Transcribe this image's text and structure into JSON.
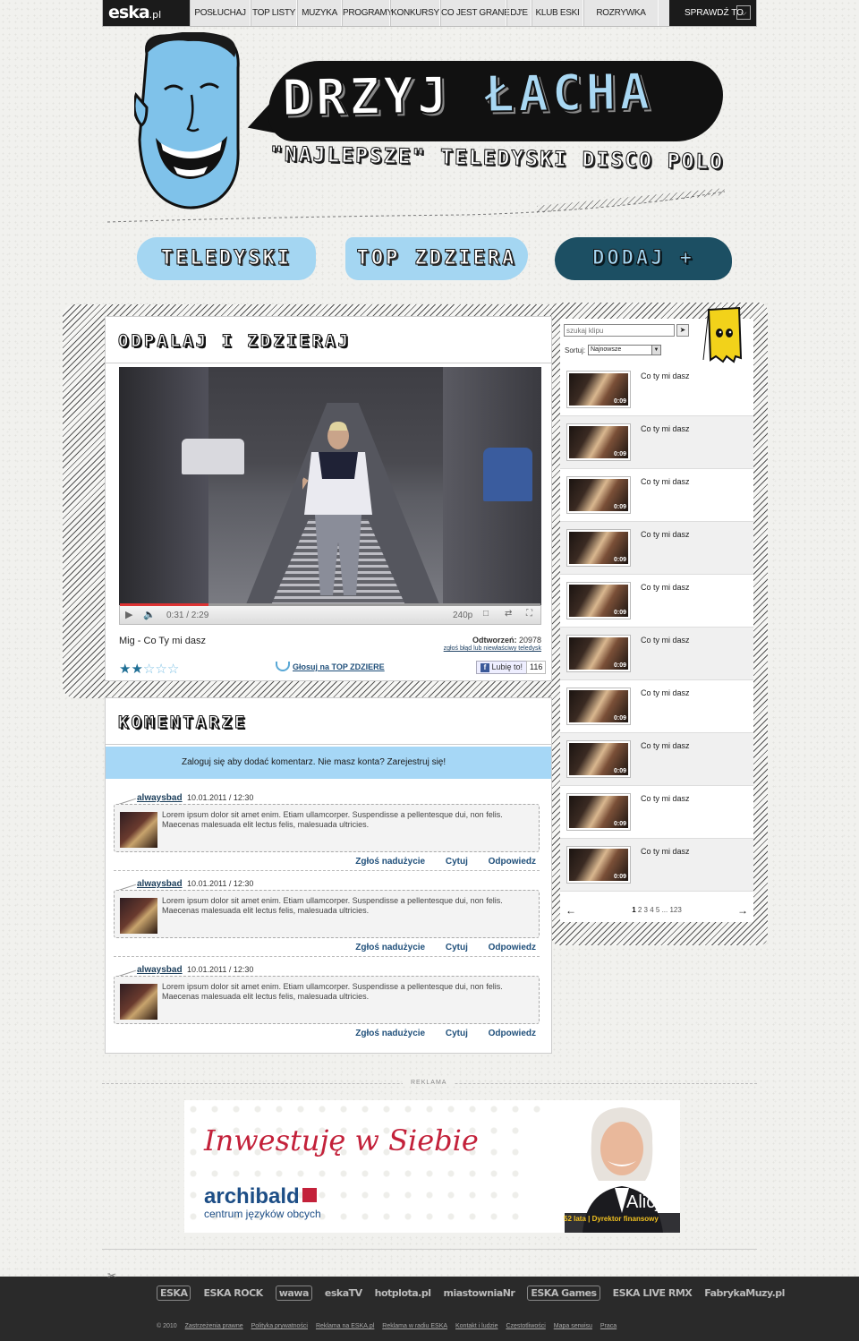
{
  "nav": {
    "logo": "eska",
    "logo_suffix": ".pl",
    "items": [
      "POSŁUCHAJ",
      "TOP LISTY",
      "MUZYKA",
      "PROGRAMY",
      "KONKURSY",
      "CO JEST GRANE",
      "DJ'E",
      "KLUB ESKI",
      "ROZRYWKA"
    ],
    "check_label": "SPRAWDŹ TO"
  },
  "header": {
    "title_part1": "DRZYJ",
    "title_part2": "ŁACHA",
    "tagline": "\"NAJLEPSZE\" TELEDYSKI DISCO POLO"
  },
  "main_buttons": [
    "TELEDYSKI",
    "TOP ZDZIERA",
    "DODAJ +"
  ],
  "video_panel": {
    "title": "ODPALAJ I ZDZIERAJ",
    "time": "0:31 / 2:29",
    "quality": "240p",
    "progress": 0.21,
    "video_name": "Mig - Co Ty mi dasz",
    "plays_label": "Odtworzeń:",
    "plays_value": "20978",
    "report_link": "zgłoś błąd lub niewłaściwy teledysk",
    "rating": 2,
    "rating_max": 5,
    "vote_label": "Głosuj na TOP ZDZIERE",
    "like_label": "Lubię to!",
    "like_count": "116"
  },
  "comments_panel": {
    "title": "KOMENTARZE",
    "login_prompt": "Zaloguj się aby dodać komentarz. Nie masz konta? Zarejestruj się!",
    "comments": [
      {
        "author": "alwaysbad",
        "date": "10.01.2011 / 12:30",
        "text": "Lorem ipsum dolor sit amet enim. Etiam ullamcorper. Suspendisse a pellentesque dui, non felis. Maecenas malesuada elit lectus felis, malesuada ultricies."
      },
      {
        "author": "alwaysbad",
        "date": "10.01.2011 / 12:30",
        "text": "Lorem ipsum dolor sit amet enim. Etiam ullamcorper. Suspendisse a pellentesque dui, non felis. Maecenas malesuada elit lectus felis, malesuada ultricies."
      },
      {
        "author": "alwaysbad",
        "date": "10.01.2011 / 12:30",
        "text": "Lorem ipsum dolor sit amet enim. Etiam ullamcorper. Suspendisse a pellentesque dui, non felis. Maecenas malesuada elit lectus felis, malesuada ultricies."
      }
    ],
    "actions": [
      "Zgłoś nadużycie",
      "Cytuj",
      "Odpowiedz"
    ]
  },
  "sidebar": {
    "search_placeholder": "szukaj klipu",
    "sort_label": "Sortuj:",
    "sort_value": "Najnowsze",
    "clips": [
      {
        "title": "Co ty mi dasz",
        "duration": "0:09"
      },
      {
        "title": "Co ty mi dasz",
        "duration": "0:09"
      },
      {
        "title": "Co ty mi dasz",
        "duration": "0:09"
      },
      {
        "title": "Co ty mi dasz",
        "duration": "0:09"
      },
      {
        "title": "Co ty mi dasz",
        "duration": "0:09"
      },
      {
        "title": "Co ty mi dasz",
        "duration": "0:09"
      },
      {
        "title": "Co ty mi dasz",
        "duration": "0:09"
      },
      {
        "title": "Co ty mi dasz",
        "duration": "0:09"
      },
      {
        "title": "Co ty mi dasz",
        "duration": "0:09"
      },
      {
        "title": "Co ty mi dasz",
        "duration": "0:09"
      }
    ],
    "pager": {
      "current": "1",
      "pages": "2 3 4 5 ... 123"
    }
  },
  "ad": {
    "label": "REKLAMA",
    "slogan": "Inwestuję w Siebie",
    "brand": "archibald",
    "brand_sub": "centrum języków obcych",
    "person_name": "Alicja",
    "person_role": "52 lata | Dyrektor finansowy"
  },
  "footer": {
    "logos": [
      "ESKA",
      "ESKA ROCK",
      "wawa",
      "eskaTV",
      "hotplota.pl",
      "miastowniaNr",
      "ESKA Games",
      "ESKA LIVE RMX",
      "FabrykaMuzy.pl"
    ],
    "copyright": "© 2010",
    "links": [
      "Zastrzeżenia prawne",
      "Polityka prywatności",
      "Reklama na ESKA.pl",
      "Reklama w radiu ESKA",
      "Kontakt i ludzie",
      "Częstotliwości",
      "Mapa serwisu",
      "Praca"
    ]
  },
  "colors": {
    "accent_blue": "#a4d6f2",
    "dark_teal": "#1c4f63",
    "ad_red": "#c3213a",
    "ad_blue": "#1d4e86"
  }
}
